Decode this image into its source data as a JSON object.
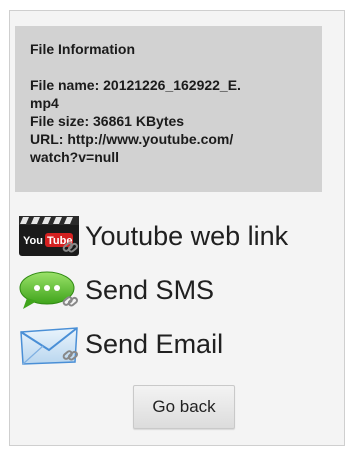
{
  "file_info": {
    "title": "File Information",
    "file_name_line1": "File name: 20121226_162922_E.",
    "file_name_line2": "mp4",
    "file_size": "File size: 36861 KBytes",
    "url_line1": "URL: http://www.youtube.com/",
    "url_line2": "watch?v=null"
  },
  "actions": [
    {
      "label": "Youtube web link",
      "icon": "youtube-icon"
    },
    {
      "label": "Send SMS",
      "icon": "sms-bubble-icon"
    },
    {
      "label": "Send Email",
      "icon": "email-envelope-icon"
    }
  ],
  "youtube_icon_text": {
    "you": "You",
    "tube": "Tube"
  },
  "go_back_label": "Go back",
  "colors": {
    "info_background": "#d2d2d2",
    "sms_green": "#5cbf2a",
    "email_blue": "#4a8fd6"
  }
}
